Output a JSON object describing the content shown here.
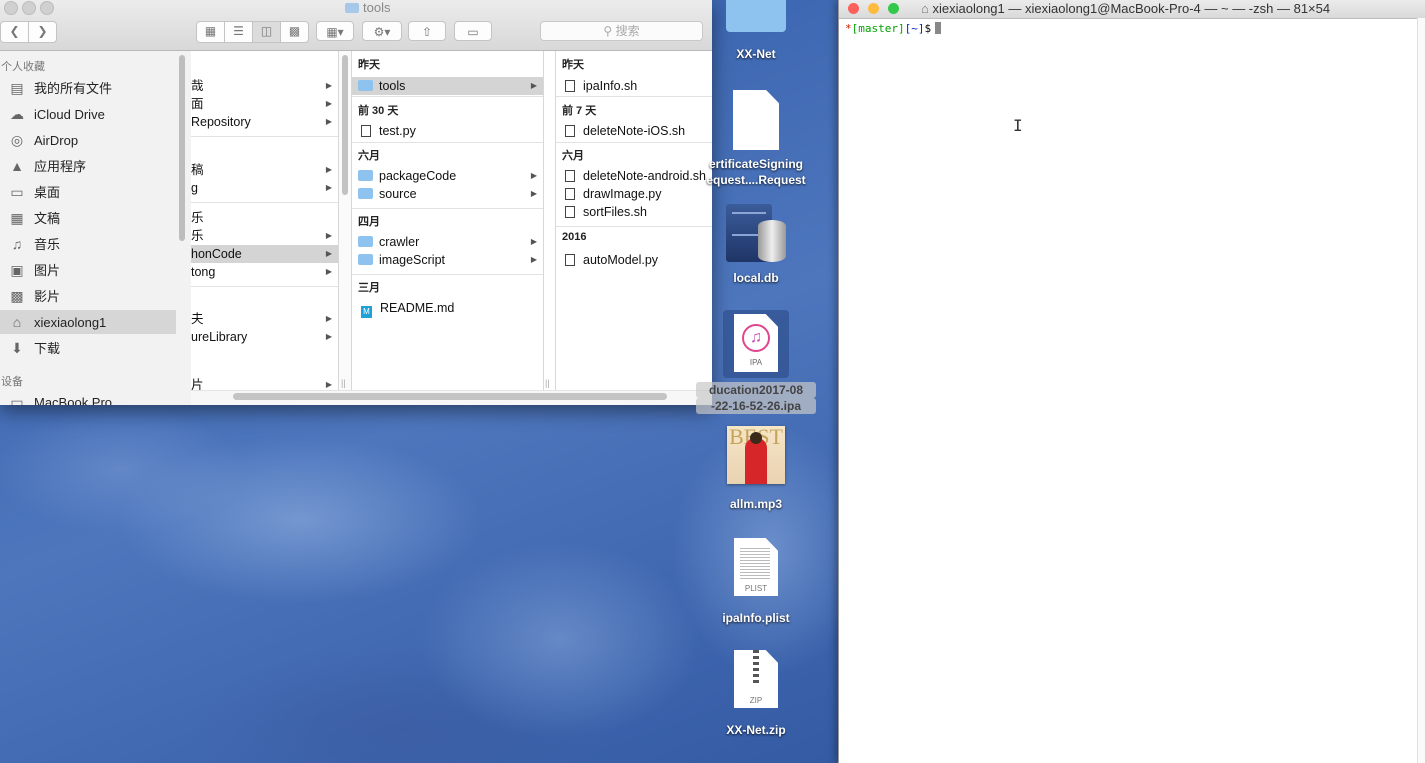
{
  "finder": {
    "title": "tools",
    "search_placeholder": "搜索",
    "sidebar": {
      "favorites_header": "个人收藏",
      "devices_header": "设备",
      "items": [
        {
          "label": "我的所有文件",
          "icon": "all-files-icon"
        },
        {
          "label": "iCloud Drive",
          "icon": "cloud-icon"
        },
        {
          "label": "AirDrop",
          "icon": "airdrop-icon"
        },
        {
          "label": "应用程序",
          "icon": "applications-icon"
        },
        {
          "label": "桌面",
          "icon": "desktop-icon"
        },
        {
          "label": "文稿",
          "icon": "documents-icon"
        },
        {
          "label": "音乐",
          "icon": "music-icon"
        },
        {
          "label": "图片",
          "icon": "pictures-icon"
        },
        {
          "label": "影片",
          "icon": "movies-icon"
        },
        {
          "label": "xiexiaolong1",
          "icon": "home-icon",
          "selected": true
        },
        {
          "label": "下载",
          "icon": "downloads-icon"
        }
      ],
      "device_item": "MacBook Pro"
    },
    "col1": [
      "哉",
      "面",
      "Repository",
      "稿",
      "g",
      "乐",
      "乐",
      "honCode",
      "tong",
      "夫",
      "ureLibrary",
      "片"
    ],
    "col2": {
      "groups": [
        {
          "header": "昨天",
          "rows": [
            {
              "name": "tools",
              "kind": "folder",
              "selected": true
            }
          ]
        },
        {
          "header": "前 30 天",
          "rows": [
            {
              "name": "test.py",
              "kind": "doc"
            }
          ]
        },
        {
          "header": "六月",
          "rows": [
            {
              "name": "packageCode",
              "kind": "folder"
            },
            {
              "name": "source",
              "kind": "folder"
            }
          ]
        },
        {
          "header": "四月",
          "rows": [
            {
              "name": "crawler",
              "kind": "folder"
            },
            {
              "name": "imageScript",
              "kind": "folder"
            }
          ]
        },
        {
          "header": "三月",
          "rows": [
            {
              "name": "README.md",
              "kind": "md"
            }
          ]
        }
      ]
    },
    "col3": {
      "groups": [
        {
          "header": "昨天",
          "rows": [
            {
              "name": "ipaInfo.sh"
            }
          ]
        },
        {
          "header": "前 7 天",
          "rows": [
            {
              "name": "deleteNote-iOS.sh"
            }
          ]
        },
        {
          "header": "六月",
          "rows": [
            {
              "name": "deleteNote-android.sh"
            },
            {
              "name": "drawImage.py"
            },
            {
              "name": "sortFiles.sh"
            }
          ]
        },
        {
          "header": "2016",
          "rows": [
            {
              "name": "autoModel.py"
            }
          ]
        }
      ]
    }
  },
  "desktop_icons": [
    {
      "label": "XX-Net",
      "kind": "folder"
    },
    {
      "label1": "ertificateSigning",
      "label2": "equest....Request",
      "kind": "document"
    },
    {
      "label": "local.db",
      "kind": "database"
    },
    {
      "label1": "ducation2017-08",
      "label2": "-22-16-52-26.ipa",
      "kind": "ipa",
      "badge": "IPA"
    },
    {
      "label": "allm.mp3",
      "kind": "mp3",
      "cover_text": "BEST"
    },
    {
      "label": "ipaInfo.plist",
      "kind": "plist",
      "badge": "PLIST"
    },
    {
      "label": "XX-Net.zip",
      "kind": "zip",
      "badge": "ZIP"
    }
  ],
  "terminal": {
    "title": "xiexiaolong1 — xiexiaolong1@MacBook-Pro-4 — ~ — -zsh — 81×54",
    "prompt_star": "*",
    "prompt_branch": "[master]",
    "prompt_dir": "[~]",
    "prompt_symbol": "$"
  },
  "colors": {
    "close": "#fc605c",
    "minimize": "#fdbc40",
    "zoom": "#34c84a",
    "folder": "#8ec3f0",
    "prompt_red": "#c91b00",
    "prompt_green": "#00a300",
    "prompt_blue": "#0225c7"
  }
}
